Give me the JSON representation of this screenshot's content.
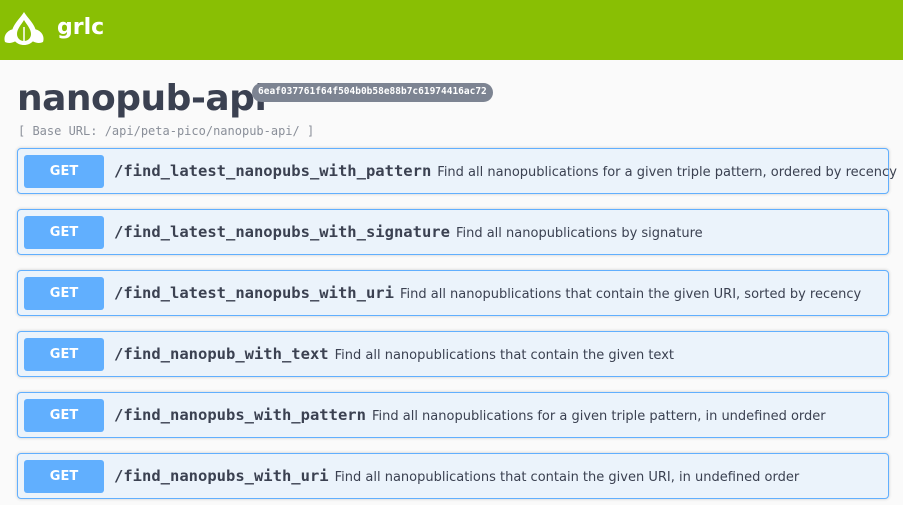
{
  "topbar": {
    "logo_text": "grlc",
    "color": "#89bf04"
  },
  "info": {
    "title": "nanopub-api",
    "version": "6eaf037761f64f504b0b58e88b7c61974416ac72",
    "base_url": "[ Base URL: /api/peta-pico/nanopub-api/ ]"
  },
  "operations": [
    {
      "method": "GET",
      "path": "/find_latest_nanopubs_with_pattern",
      "summary": "Find all nanopublications for a given triple pattern, ordered by recency"
    },
    {
      "method": "GET",
      "path": "/find_latest_nanopubs_with_signature",
      "summary": "Find all nanopublications by signature"
    },
    {
      "method": "GET",
      "path": "/find_latest_nanopubs_with_uri",
      "summary": "Find all nanopublications that contain the given URI, sorted by recency"
    },
    {
      "method": "GET",
      "path": "/find_nanopub_with_text",
      "summary": "Find all nanopublications that contain the given text"
    },
    {
      "method": "GET",
      "path": "/find_nanopubs_with_pattern",
      "summary": "Find all nanopublications for a given triple pattern, in undefined order"
    },
    {
      "method": "GET",
      "path": "/find_nanopubs_with_uri",
      "summary": "Find all nanopublications that contain the given URI, in undefined order"
    }
  ],
  "colors": {
    "get_accent": "#61affe",
    "op_background": "#ebf3fb"
  }
}
